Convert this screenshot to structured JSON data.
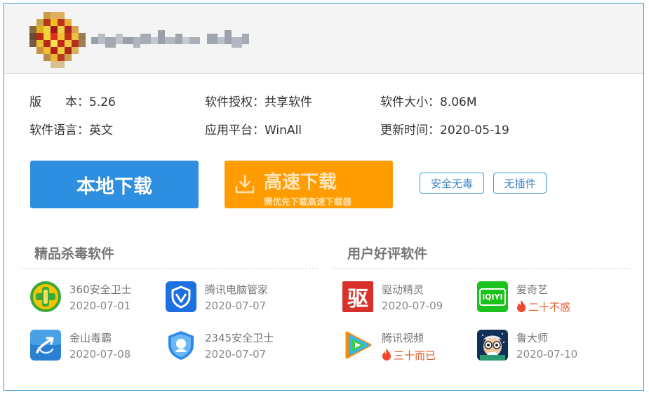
{
  "header": {
    "title_obscured": true
  },
  "info": {
    "version": {
      "label": "版　　本：",
      "value": "5.26"
    },
    "license": {
      "label": "软件授权：",
      "value": "共享软件"
    },
    "size": {
      "label": "软件大小：",
      "value": "8.06M"
    },
    "language": {
      "label": "软件语言：",
      "value": "英文"
    },
    "platform": {
      "label": "应用平台：",
      "value": "WinAll"
    },
    "updated": {
      "label": "更新时间：",
      "value": "2020-05-19"
    }
  },
  "actions": {
    "local_download": "本地下载",
    "fast_download": "高速下载",
    "fast_download_sub": "需优先下载高速下载器",
    "badge_safe": "安全无毒",
    "badge_noplugin": "无插件"
  },
  "sections": {
    "antivirus": {
      "title": "精品杀毒软件",
      "apps": [
        {
          "name": "360安全卫士",
          "date": "2020-07-01",
          "icon": "360-shield-icon"
        },
        {
          "name": "腾讯电脑管家",
          "date": "2020-07-07",
          "icon": "tencent-pc-manager-icon"
        },
        {
          "name": "金山毒霸",
          "date": "2020-07-08",
          "icon": "kingsoft-antivirus-icon"
        },
        {
          "name": "2345安全卫士",
          "date": "2020-07-07",
          "icon": "2345-shield-icon"
        }
      ]
    },
    "rated": {
      "title": "用户好评软件",
      "apps": [
        {
          "name": "驱动精灵",
          "date": "2020-07-09",
          "icon": "driver-genius-icon",
          "glyph": "驱"
        },
        {
          "name": "爱奇艺",
          "hot": "二十不惑",
          "icon": "iqiyi-icon",
          "glyph": "iQIYI"
        },
        {
          "name": "腾讯视频",
          "hot": "三十而已",
          "icon": "tencent-video-icon"
        },
        {
          "name": "鲁大师",
          "date": "2020-07-10",
          "icon": "ludashi-icon"
        }
      ]
    }
  },
  "colors": {
    "accent_blue": "#2e8fe0",
    "accent_orange": "#ff9c00",
    "border_blue": "#3a9bd5",
    "hot_red": "#e25a2a"
  }
}
